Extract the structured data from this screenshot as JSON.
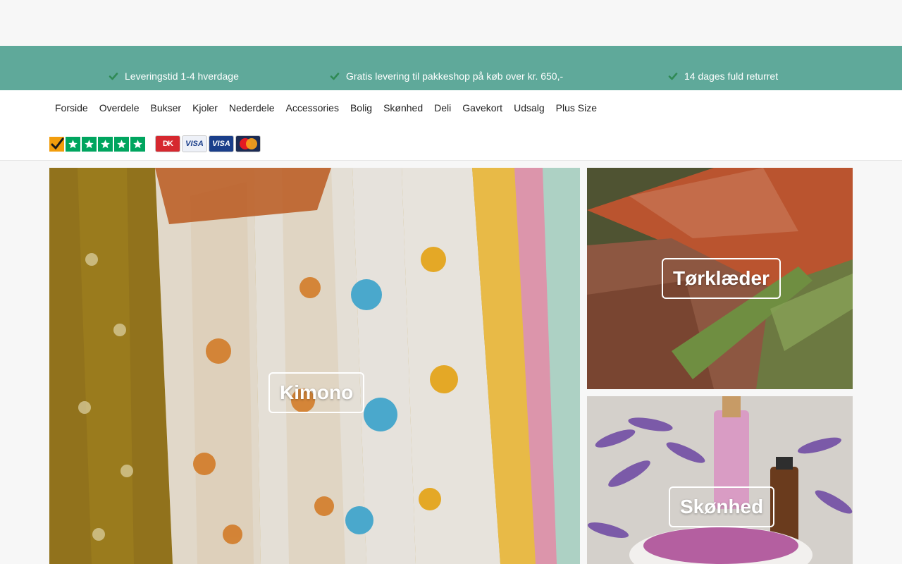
{
  "usp": [
    {
      "text": "Leveringstid 1-4 hverdage",
      "icon": "check-icon"
    },
    {
      "text": "Gratis levering til pakkeshop på køb over kr. 650,-",
      "icon": "check-icon"
    },
    {
      "text": "14 dages fuld returret",
      "icon": "check-icon"
    }
  ],
  "nav": [
    "Forside",
    "Overdele",
    "Bukser",
    "Kjoler",
    "Nederdele",
    "Accessories",
    "Bolig",
    "Skønhed",
    "Deli",
    "Gavekort",
    "Udsalg",
    "Plus Size"
  ],
  "payments": {
    "dk": "DK",
    "visa": "VISA",
    "visa_electron": "VISA",
    "mastercard": "mastercard"
  },
  "tiles": {
    "kimono": "Kimono",
    "scarf": "Tørklæder",
    "beauty": "Skønhed"
  },
  "colors": {
    "accent": "#5fa99a",
    "trustpilot": "#00a55f"
  }
}
